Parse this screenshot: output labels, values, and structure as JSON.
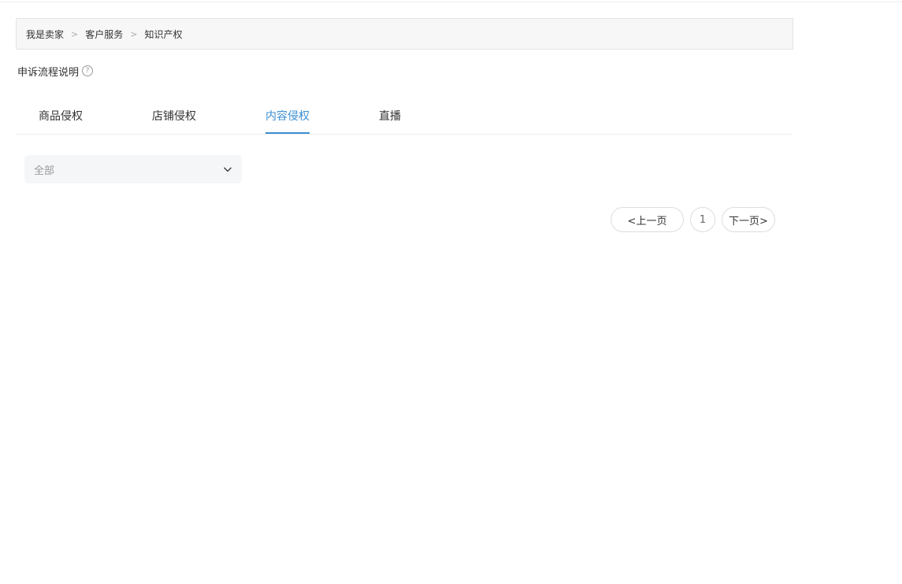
{
  "breadcrumb": {
    "items": [
      "我是卖家",
      "客户服务",
      "知识产权"
    ],
    "separator": ">"
  },
  "help": {
    "label": "申诉流程说明",
    "icon": "question-circle-icon",
    "icon_glyph": "?"
  },
  "tabs": [
    {
      "label": "商品侵权",
      "active": false
    },
    {
      "label": "店铺侵权",
      "active": false
    },
    {
      "label": "内容侵权",
      "active": true
    },
    {
      "label": "直播",
      "active": false
    }
  ],
  "filter": {
    "selected": "全部",
    "icon": "chevron-down-icon"
  },
  "pagination": {
    "prev_label": "<上一页",
    "current_page": "1",
    "next_label": "下一页>"
  },
  "colors": {
    "accent": "#3d8fd1",
    "text": "#333333",
    "muted": "#999999",
    "breadcrumb_bg": "#f7f7f7",
    "select_bg": "#f5f6f8",
    "border": "#dddddd"
  }
}
